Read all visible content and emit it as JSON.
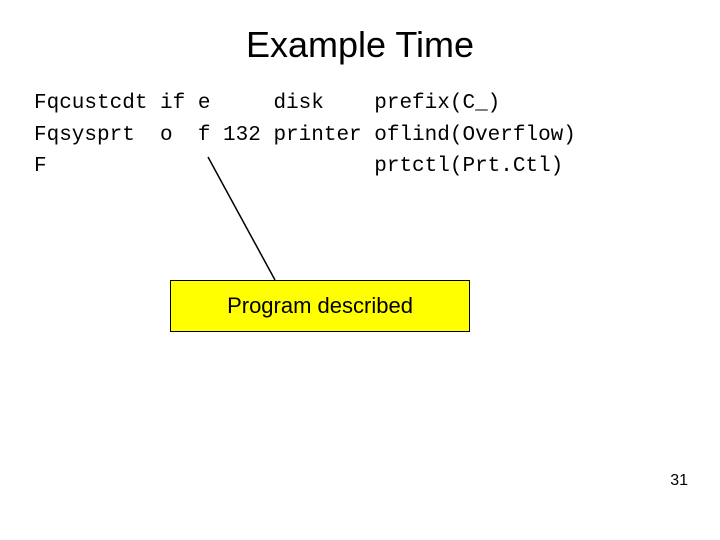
{
  "slide": {
    "title": "Example Time",
    "code": {
      "line1": "Fqcustcdt if e     disk    prefix(C_)",
      "line2": "Fqsysprt  o  f 132 printer oflind(Overflow)",
      "line3": "F                          prtctl(Prt.Ctl)"
    },
    "callout": "Program described",
    "page_number": "31"
  }
}
